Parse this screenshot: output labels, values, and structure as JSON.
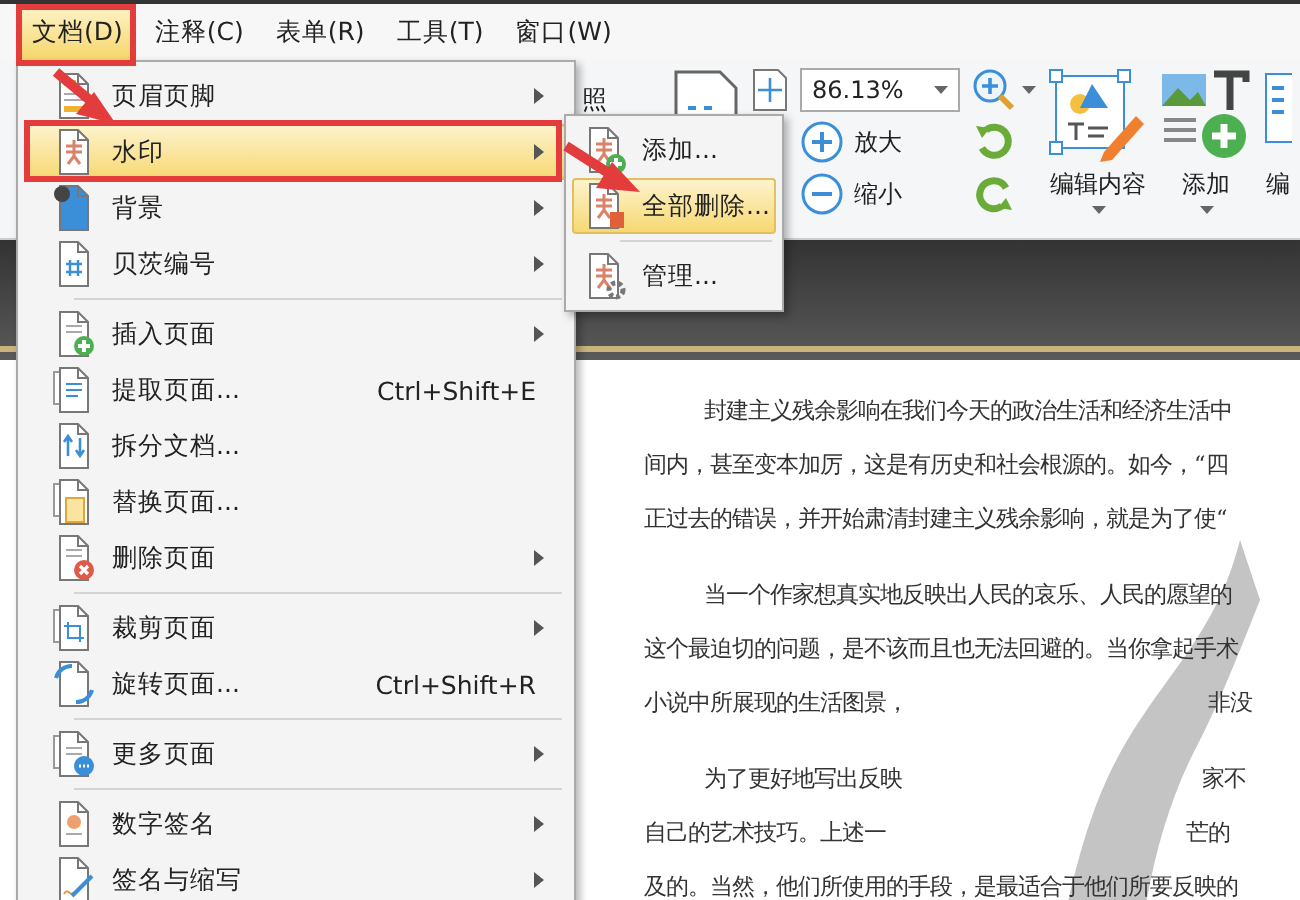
{
  "menu_bar": [
    {
      "label": "文档(D)",
      "selected": true
    },
    {
      "label": "注释(C)",
      "selected": false
    },
    {
      "label": "表单(R)",
      "selected": false
    },
    {
      "label": "工具(T)",
      "selected": false
    },
    {
      "label": "窗口(W)",
      "selected": false
    }
  ],
  "document_menu": {
    "items": [
      {
        "kind": "item",
        "label": "页眉页脚",
        "submenu": true,
        "selected": false
      },
      {
        "kind": "item",
        "label": "水印",
        "submenu": true,
        "selected": true
      },
      {
        "kind": "item",
        "label": "背景",
        "submenu": true,
        "selected": false
      },
      {
        "kind": "item",
        "label": "贝茨编号",
        "submenu": true,
        "selected": false
      },
      {
        "kind": "separator"
      },
      {
        "kind": "item",
        "label": "插入页面",
        "submenu": true,
        "selected": false
      },
      {
        "kind": "item",
        "label": "提取页面...",
        "shortcut": "Ctrl+Shift+E",
        "submenu": false,
        "selected": false
      },
      {
        "kind": "item",
        "label": "拆分文档...",
        "submenu": false,
        "selected": false
      },
      {
        "kind": "item",
        "label": "替换页面...",
        "submenu": false,
        "selected": false
      },
      {
        "kind": "item",
        "label": "删除页面",
        "submenu": true,
        "selected": false
      },
      {
        "kind": "separator"
      },
      {
        "kind": "item",
        "label": "裁剪页面",
        "submenu": true,
        "selected": false
      },
      {
        "kind": "item",
        "label": "旋转页面...",
        "shortcut": "Ctrl+Shift+R",
        "submenu": false,
        "selected": false
      },
      {
        "kind": "separator"
      },
      {
        "kind": "item",
        "label": "更多页面",
        "submenu": true,
        "selected": false
      },
      {
        "kind": "separator"
      },
      {
        "kind": "item",
        "label": "数字签名",
        "submenu": true,
        "selected": false
      },
      {
        "kind": "item",
        "label": "签名与缩写",
        "submenu": true,
        "selected": false
      }
    ]
  },
  "watermark_submenu": {
    "items": [
      {
        "kind": "item",
        "label": "添加...",
        "selected": false
      },
      {
        "kind": "item",
        "label": "全部删除...",
        "selected": true
      },
      {
        "kind": "separator"
      },
      {
        "kind": "item",
        "label": "管理...",
        "selected": false
      }
    ]
  },
  "toolbar": {
    "partial_label": "照",
    "zoom_value": "86.13%",
    "zoom_in": "放大",
    "zoom_out": "缩小",
    "edit_content": "编辑内容",
    "add": "添加",
    "cut_label": "编"
  },
  "document": {
    "paragraphs": [
      {
        "lines": [
          [
            "封建主义残余影响在我们今天的政治生活和经济生活中"
          ],
          [
            "间内，甚至变本加厉，这是有历史和社会根源的。如今，“四"
          ],
          [
            "正过去的错误，并开始肃清封建主义残余影响，就是为了使“"
          ]
        ]
      },
      {
        "lines": [
          [
            "当一个作家想真实地反映出人民的哀乐、人民的愿望的"
          ],
          [
            "这个最迫切的问题，是不该而且也无法回避的。当你拿起手术"
          ],
          [
            "小说中所展现的生活图景，",
            "非没"
          ]
        ]
      },
      {
        "lines": [
          [
            "为了更好地写出反映",
            "家不"
          ],
          [
            "自己的艺术技巧。上述一",
            "芒的"
          ],
          [
            "及的。当然，他们所使用的手段，是最适合于他们所要反映的"
          ]
        ]
      }
    ]
  }
}
